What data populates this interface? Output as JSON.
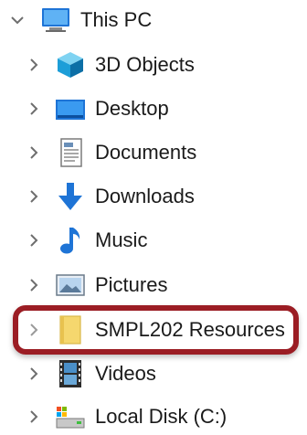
{
  "tree": {
    "root": {
      "label": "This PC",
      "icon": "monitor-icon",
      "expanded": true
    },
    "items": [
      {
        "label": "3D Objects",
        "icon": "3d-objects-icon"
      },
      {
        "label": "Desktop",
        "icon": "desktop-icon"
      },
      {
        "label": "Documents",
        "icon": "documents-icon"
      },
      {
        "label": "Downloads",
        "icon": "downloads-icon"
      },
      {
        "label": "Music",
        "icon": "music-note-icon"
      },
      {
        "label": "Pictures",
        "icon": "pictures-icon"
      },
      {
        "label": "SMPL202 Resources",
        "icon": "folder-icon",
        "highlighted": true
      },
      {
        "label": "Videos",
        "icon": "film-strip-icon"
      },
      {
        "label": "Local Disk (C:)",
        "icon": "local-disk-icon"
      }
    ]
  },
  "colors": {
    "highlight_border": "#9b1d24",
    "chevron": "#6e6e6e",
    "folder": "#f5d76e",
    "accent_blue": "#1e74d6"
  }
}
